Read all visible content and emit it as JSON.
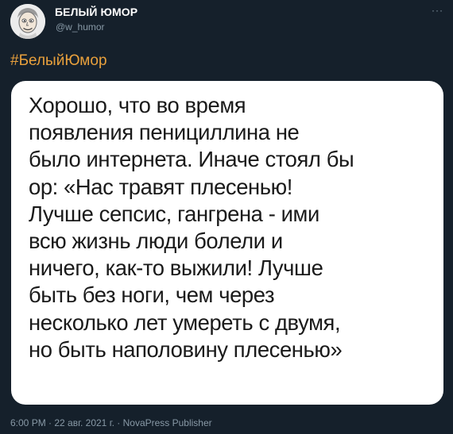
{
  "author": {
    "name": "БЕЛЫЙ ЮМОР",
    "handle": "@w_humor",
    "avatar_icon": "cartoon-face-avatar"
  },
  "menu": {
    "more_icon": "more-horizontal-icon",
    "more_label": "···"
  },
  "tweet": {
    "hashtag": "#БелыйЮмор",
    "image_text": "Хорошо, что во время\nпоявления пенициллина не\nбыло интернета. Иначе стоял бы\nор: «Нас травят плесенью!\nЛучше сепсис, гангрена - ими\nвсю жизнь люди болели и\nничего, как-то выжили! Лучше\nбыть без ноги, чем через\nнесколько лет умереть с двумя,\nно быть наполовину плесенью»",
    "meta": "6:00 PM · 22 авг. 2021 г. · NovaPress Publisher"
  },
  "colors": {
    "background": "#15202b",
    "hashtag": "#e8a03c",
    "secondary_text": "#8899a6",
    "card_background": "#ffffff"
  }
}
